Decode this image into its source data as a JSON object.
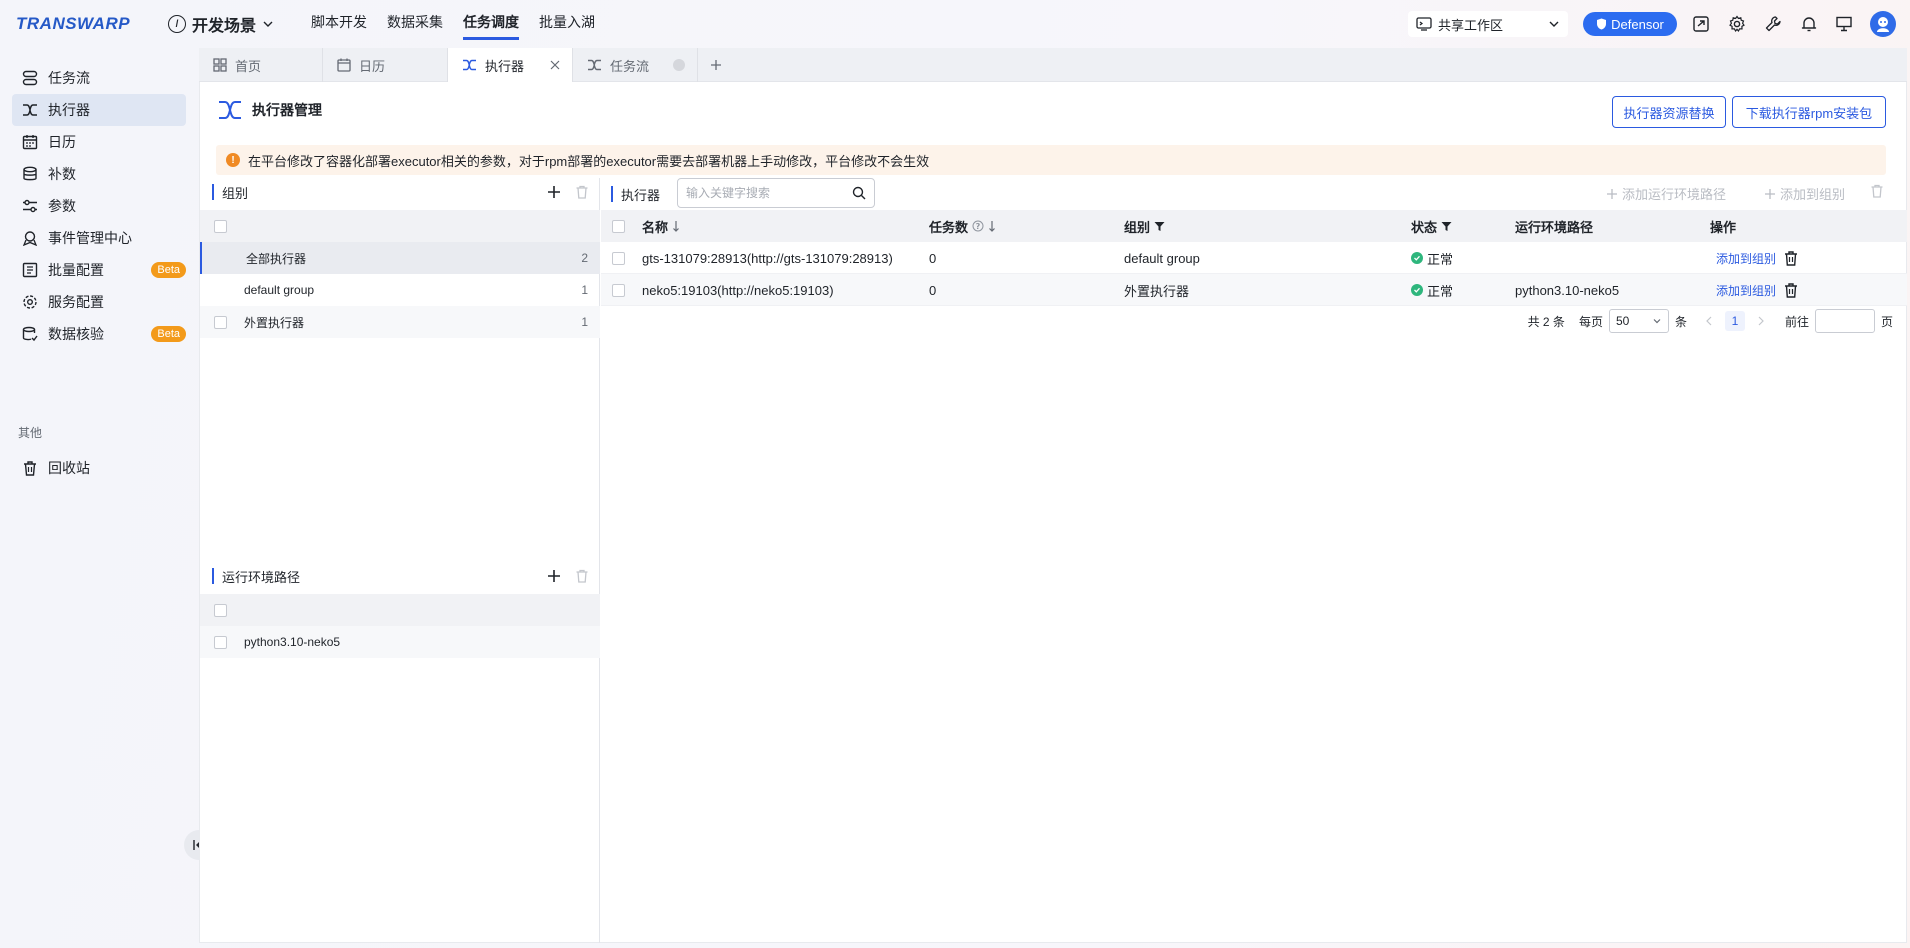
{
  "brand": {
    "logo_text": "TRANSWARP"
  },
  "header": {
    "scene_label": "开发场景",
    "nav": [
      "脚本开发",
      "数据采集",
      "任务调度",
      "批量入湖"
    ],
    "active_nav": "任务调度",
    "workspace": "共享工作区",
    "defender_label": "Defensor"
  },
  "sidebar": {
    "items": [
      {
        "label": "任务流",
        "icon": "workflow-icon"
      },
      {
        "label": "执行器",
        "icon": "executor-icon"
      },
      {
        "label": "日历",
        "icon": "calendar-icon"
      },
      {
        "label": "补数",
        "icon": "database-icon"
      },
      {
        "label": "参数",
        "icon": "sliders-icon"
      },
      {
        "label": "事件管理中心",
        "icon": "event-icon"
      },
      {
        "label": "批量配置",
        "icon": "batch-config-icon",
        "badge": "Beta"
      },
      {
        "label": "服务配置",
        "icon": "gear-icon"
      },
      {
        "label": "数据核验",
        "icon": "data-check-icon",
        "badge": "Beta"
      }
    ],
    "group_label": "其他",
    "other_items": [
      {
        "label": "回收站",
        "icon": "trash-icon"
      }
    ]
  },
  "tabs": [
    {
      "label": "首页",
      "icon": "grid-icon"
    },
    {
      "label": "日历",
      "icon": "calendar-icon"
    },
    {
      "label": "执行器",
      "icon": "executor-icon",
      "active": true
    },
    {
      "label": "任务流",
      "icon": "workflow-icon"
    }
  ],
  "page": {
    "title": "执行器管理",
    "btn_replace": "执行器资源替换",
    "btn_download": "下载执行器rpm安装包",
    "alert": "在平台修改了容器化部署executor相关的参数，对于rpm部署的executor需要去部署机器上手动修改，平台修改不会生效"
  },
  "groups": {
    "title": "组别",
    "rows": [
      {
        "name": "全部执行器",
        "count": "2"
      },
      {
        "name": "default group",
        "count": "1"
      },
      {
        "name": "外置执行器",
        "count": "1"
      }
    ]
  },
  "envpaths": {
    "title": "运行环境路径",
    "rows": [
      {
        "name": "python3.10-neko5"
      }
    ]
  },
  "executors": {
    "title": "执行器",
    "search_placeholder": "输入关键字搜索",
    "btn_add_env": "添加运行环境路径",
    "btn_add_group": "添加到组别",
    "columns": {
      "name": "名称",
      "tasks": "任务数",
      "group": "组别",
      "status": "状态",
      "env": "运行环境路径",
      "ops": "操作"
    },
    "rows": [
      {
        "name": "gts-131079:28913(http://gts-131079:28913)",
        "tasks": "0",
        "group": "default group",
        "status": "正常",
        "env": "",
        "op": "添加到组别"
      },
      {
        "name": "neko5:19103(http://neko5:19103)",
        "tasks": "0",
        "group": "外置执行器",
        "status": "正常",
        "env": "python3.10-neko5",
        "op": "添加到组别"
      }
    ]
  },
  "pager": {
    "total": "共 2 条",
    "per_page_label": "每页",
    "per_page": "50",
    "unit": "条",
    "current": "1",
    "goto_label": "前往",
    "page_unit": "页"
  }
}
